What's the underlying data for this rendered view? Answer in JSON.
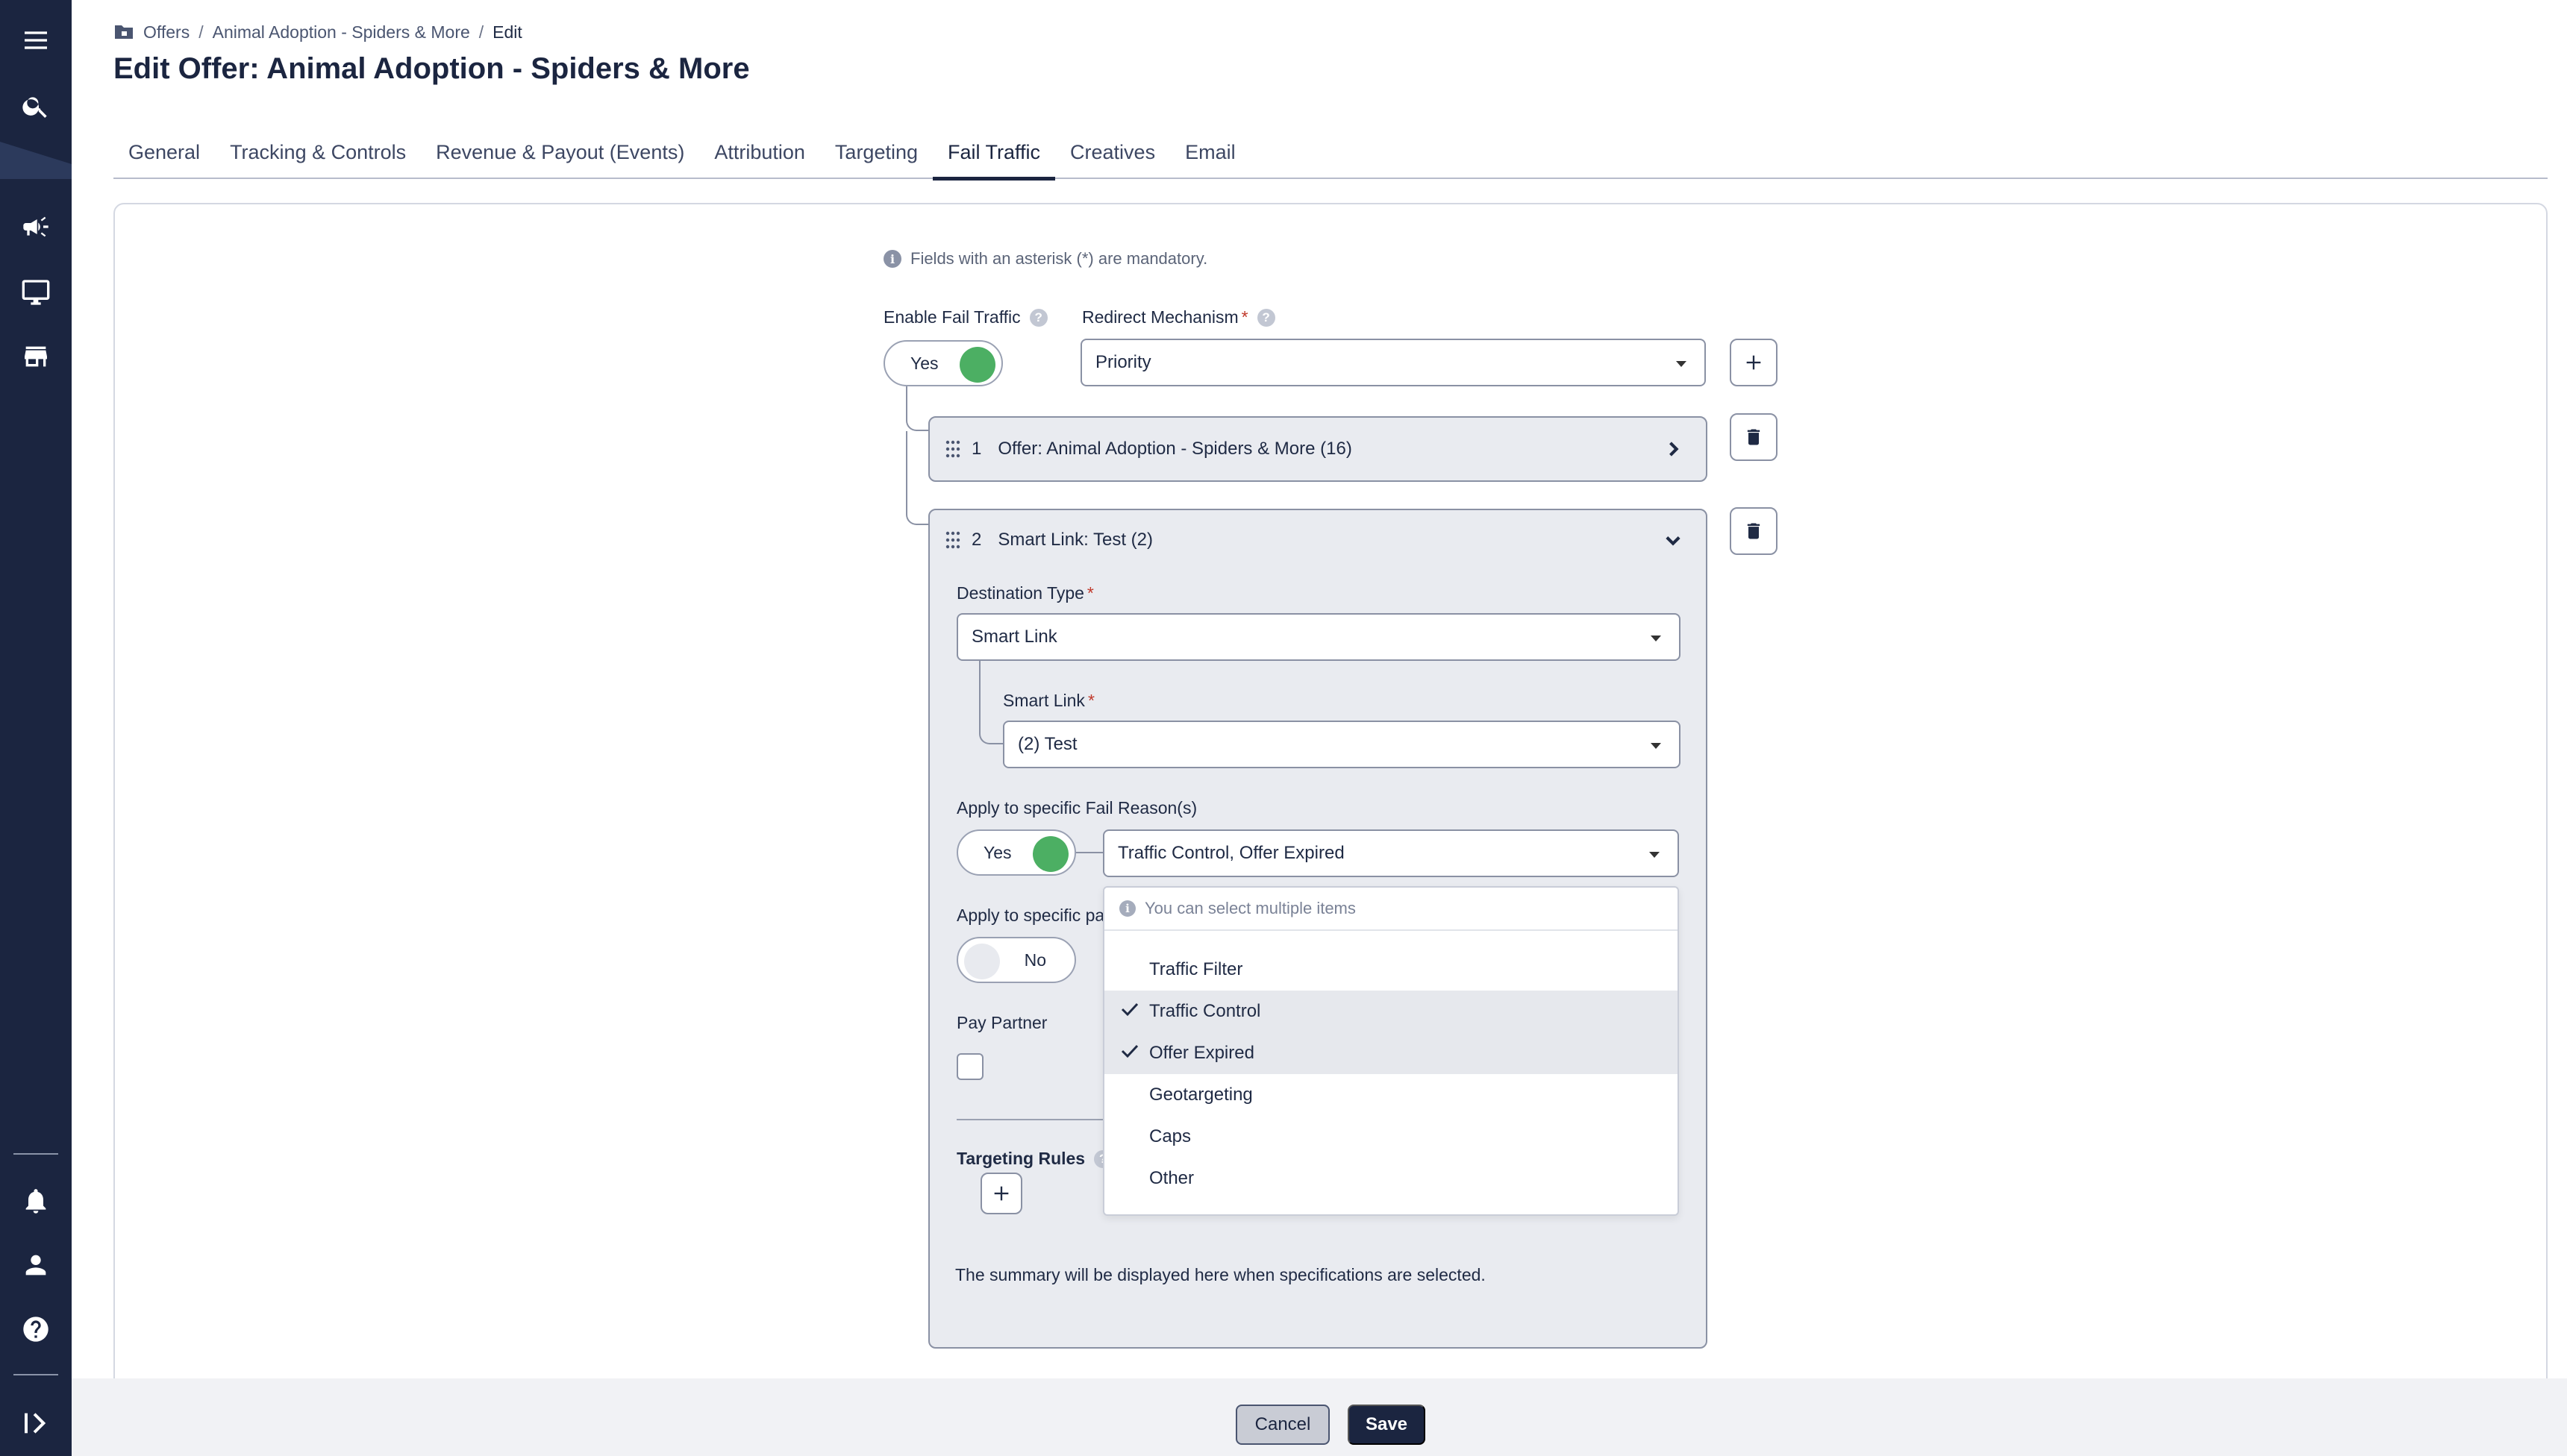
{
  "breadcrumb": {
    "items": [
      "Offers",
      "Animal Adoption - Spiders & More",
      "Edit"
    ]
  },
  "page_title": "Edit Offer: Animal Adoption - Spiders & More",
  "tabs": [
    "General",
    "Tracking & Controls",
    "Revenue & Payout (Events)",
    "Attribution",
    "Targeting",
    "Fail Traffic",
    "Creatives",
    "Email"
  ],
  "active_tab": "Fail Traffic",
  "form": {
    "mandatory_note": "Fields with an asterisk (*) are mandatory.",
    "enable_fail_traffic": {
      "label": "Enable Fail Traffic",
      "value": "Yes"
    },
    "redirect_mechanism": {
      "label": "Redirect Mechanism",
      "required": "*",
      "value": "Priority"
    },
    "items": [
      {
        "index": "1",
        "title": "Offer: Animal Adoption - Spiders & More (16)"
      },
      {
        "index": "2",
        "title": "Smart Link: Test (2)"
      }
    ],
    "destination_type": {
      "label": "Destination Type",
      "required": "*",
      "value": "Smart Link"
    },
    "smart_link": {
      "label": "Smart Link",
      "required": "*",
      "value": "(2) Test"
    },
    "fail_reasons": {
      "label": "Apply to specific Fail Reason(s)",
      "toggle": "Yes",
      "value": "Traffic Control, Offer Expired"
    },
    "specific_partners": {
      "label": "Apply to specific pa",
      "toggle": "No"
    },
    "pay_partner": {
      "label": "Pay Partner"
    },
    "targeting_rules": {
      "label": "Targeting Rules"
    },
    "summary": "The summary will be displayed here when specifications are selected."
  },
  "fail_reason_menu": {
    "note": "You can select multiple items",
    "options": [
      {
        "label": "Traffic Filter",
        "selected": false
      },
      {
        "label": "Traffic Control",
        "selected": true
      },
      {
        "label": "Offer Expired",
        "selected": true
      },
      {
        "label": "Geotargeting",
        "selected": false
      },
      {
        "label": "Caps",
        "selected": false
      },
      {
        "label": "Other",
        "selected": false
      }
    ]
  },
  "footer": {
    "cancel": "Cancel",
    "save": "Save"
  },
  "colors": {
    "sidebar": "#1b2540",
    "toggle_on": "#4caf63",
    "primary": "#1b2540"
  },
  "icons": [
    "menu-icon",
    "search-icon",
    "megaphone-icon",
    "monitor-icon",
    "store-icon",
    "bell-icon",
    "user-icon",
    "help-icon",
    "expand-sidebar-icon"
  ]
}
